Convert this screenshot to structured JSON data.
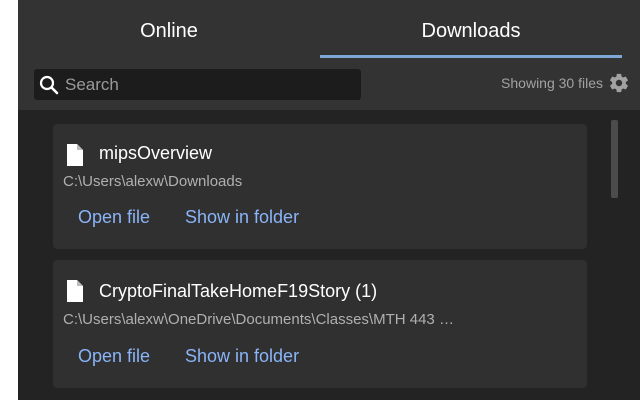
{
  "tabs": [
    {
      "label": "Online",
      "active": false
    },
    {
      "label": "Downloads",
      "active": true
    }
  ],
  "colors": {
    "accent": "#7ea7d8",
    "link": "#8ab4f8",
    "background": "#232323",
    "card": "#303030"
  },
  "search": {
    "placeholder": "Search",
    "value": ""
  },
  "status": {
    "count_text": "Showing 30 files"
  },
  "downloads": [
    {
      "icon": "file-icon",
      "name": "mipsOverview",
      "path": "C:\\Users\\alexw\\Downloads",
      "open_label": "Open file",
      "show_label": "Show in folder"
    },
    {
      "icon": "file-icon",
      "name": "CryptoFinalTakeHomeF19Story (1)",
      "path": "C:\\Users\\alexw\\OneDrive\\Documents\\Classes\\MTH 443 …",
      "open_label": "Open file",
      "show_label": "Show in folder"
    }
  ]
}
